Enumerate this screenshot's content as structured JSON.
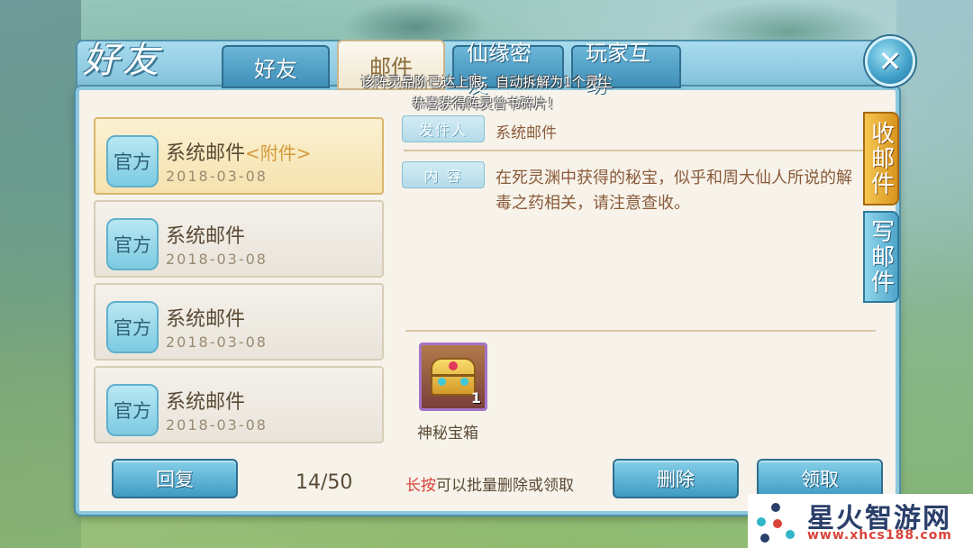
{
  "header": {
    "title": "好友",
    "tabs": [
      {
        "label": "好友"
      },
      {
        "label": "邮件"
      },
      {
        "label": "仙缘密友"
      },
      {
        "label": "玩家互助"
      }
    ],
    "close_label": "✕"
  },
  "toasts": [
    "该阵灵品阶已达上限，自动拆解为1个灵尘",
    "恭喜获得阵灵曾书碎片！"
  ],
  "mail_list": [
    {
      "badge": "官方",
      "title": "系统邮件",
      "attachment_tag": "<附件>",
      "date": "2018-03-08",
      "selected": true
    },
    {
      "badge": "官方",
      "title": "系统邮件",
      "attachment_tag": "",
      "date": "2018-03-08",
      "selected": false
    },
    {
      "badge": "官方",
      "title": "系统邮件",
      "attachment_tag": "",
      "date": "2018-03-08",
      "selected": false
    },
    {
      "badge": "官方",
      "title": "系统邮件",
      "attachment_tag": "",
      "date": "2018-03-08",
      "selected": false
    }
  ],
  "detail": {
    "sender_label": "发件人",
    "sender_value": "系统邮件",
    "content_label": "内  容",
    "content_text": "在死灵渊中获得的秘宝，似乎和周大仙人所说的解毒之药相关，请注意查收。",
    "attachment": {
      "name": "神秘宝箱",
      "count": "1",
      "icon": "treasure-chest-icon"
    }
  },
  "side_tabs": {
    "inbox": "收邮件",
    "compose": "写邮件"
  },
  "footer": {
    "reply_label": "回复",
    "page_count": "14/50",
    "hint_highlight": "长按",
    "hint_rest": "可以批量删除或领取",
    "delete_label": "删除",
    "claim_label": "领取"
  },
  "watermark": {
    "title": "星火智游网",
    "url": "www.xhcs188.com"
  },
  "colors": {
    "accent_blue": "#3f9ac2",
    "selected_gold": "#f5e2ae",
    "attachment_orange": "#d59a3a",
    "hint_red": "#d9433a",
    "text_brown": "#8a5a3a"
  }
}
